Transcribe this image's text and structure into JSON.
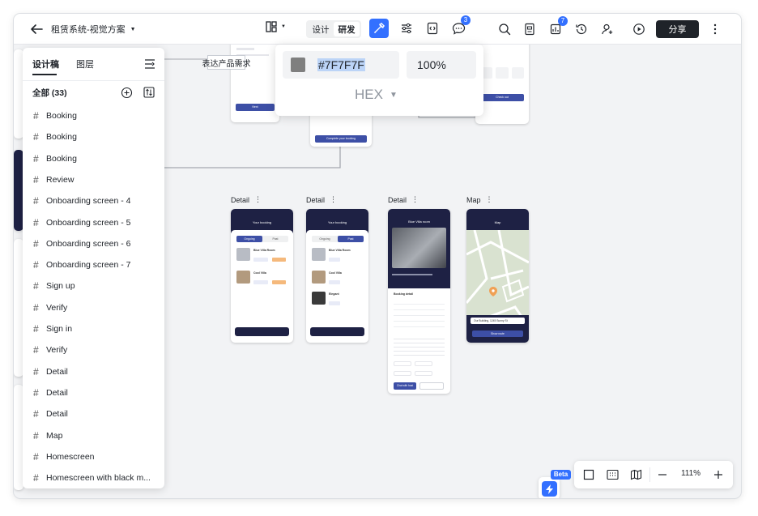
{
  "header": {
    "doc_title": "租赁系统-视觉方案",
    "mode_design": "设计",
    "mode_dev": "研发",
    "share_label": "分享",
    "comments_badge": "3",
    "notifications_badge": "7"
  },
  "layers_panel": {
    "tab_design": "设计稿",
    "tab_layers": "图层",
    "all_label": "全部 (33)",
    "items": [
      "Booking",
      "Booking",
      "Booking",
      "Review",
      "Onboarding screen - 4",
      "Onboarding screen - 5",
      "Onboarding screen - 6",
      "Onboarding screen - 7",
      "Sign up",
      "Verify",
      "Sign in",
      "Verify",
      "Detail",
      "Detail",
      "Detail",
      "Map",
      "Homescreen",
      "Homescreen with black m..."
    ]
  },
  "color_picker": {
    "hex_value": "#7F7F7F",
    "opacity": "100%",
    "format": "HEX",
    "swatch_color": "#7f7f7f"
  },
  "canvas": {
    "note_text": "表达产品需求",
    "frames": [
      {
        "label": "Detail",
        "header": "Your booking",
        "tab_a": "Ongoing",
        "tab_b": "Past"
      },
      {
        "label": "Detail",
        "header": "Your booking",
        "tab_a": "Ongoing",
        "tab_b": "Past"
      },
      {
        "label": "Detail",
        "header": "Blue Villa room",
        "section": "Booking detail",
        "btn": "Chat with host"
      },
      {
        "label": "Map",
        "header": "Map",
        "address": "Our Building, 1245 Sunny St",
        "btn": "Show route"
      }
    ],
    "list_rows": [
      "Blue Villa Room",
      "Cool Villa",
      "Elegant"
    ],
    "complete_btn": "Complete your booking",
    "check_out_btn": "Check out",
    "next_btn": "Next"
  },
  "zoom": {
    "beta_label": "Beta",
    "level": "111%"
  },
  "colors": {
    "accent": "#3370ff",
    "navy": "#1e2144",
    "button_blue": "#3d4fa6"
  }
}
